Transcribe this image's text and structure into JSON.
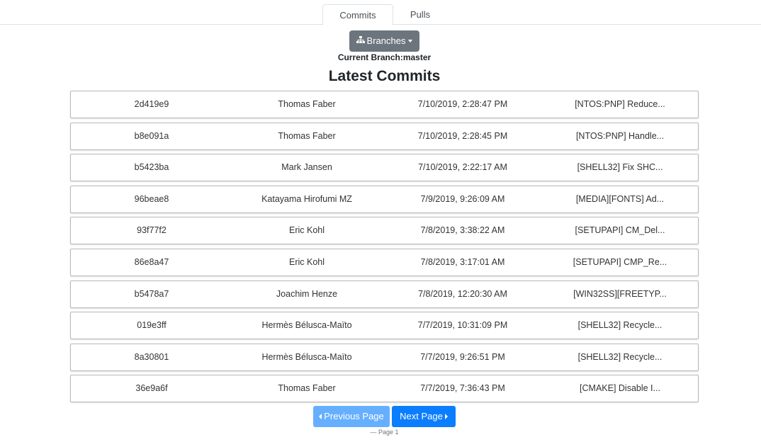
{
  "tabs": [
    {
      "label": "Commits",
      "active": true
    },
    {
      "label": "Pulls",
      "active": false
    }
  ],
  "branch_button": {
    "label": "Branches",
    "icon": "sitemap-icon"
  },
  "current_branch": "Current Branch:master",
  "title": "Latest Commits",
  "commits": [
    {
      "hash": "2d419e9",
      "author": "Thomas Faber",
      "date": "7/10/2019, 2:28:47 PM",
      "message": "[NTOS:PNP] Reduce..."
    },
    {
      "hash": "b8e091a",
      "author": "Thomas Faber",
      "date": "7/10/2019, 2:28:45 PM",
      "message": "[NTOS:PNP] Handle..."
    },
    {
      "hash": "b5423ba",
      "author": "Mark Jansen",
      "date": "7/10/2019, 2:22:17 AM",
      "message": "[SHELL32] Fix SHC..."
    },
    {
      "hash": "96beae8",
      "author": "Katayama Hirofumi MZ",
      "date": "7/9/2019, 9:26:09 AM",
      "message": "[MEDIA][FONTS] Ad..."
    },
    {
      "hash": "93f77f2",
      "author": "Eric Kohl",
      "date": "7/8/2019, 3:38:22 AM",
      "message": "[SETUPAPI] CM_Del..."
    },
    {
      "hash": "86e8a47",
      "author": "Eric Kohl",
      "date": "7/8/2019, 3:17:01 AM",
      "message": "[SETUPAPI] CMP_Re..."
    },
    {
      "hash": "b5478a7",
      "author": "Joachim Henze",
      "date": "7/8/2019, 12:20:30 AM",
      "message": "[WIN32SS][FREETYP..."
    },
    {
      "hash": "019e3ff",
      "author": "Hermès Bélusca-Maïto",
      "date": "7/7/2019, 10:31:09 PM",
      "message": "[SHELL32] Recycle..."
    },
    {
      "hash": "8a30801",
      "author": "Hermès Bélusca-Maïto",
      "date": "7/7/2019, 9:26:51 PM",
      "message": "[SHELL32] Recycle..."
    },
    {
      "hash": "36e9a6f",
      "author": "Thomas Faber",
      "date": "7/7/2019, 7:36:43 PM",
      "message": "[CMAKE] Disable I..."
    }
  ],
  "pagination": {
    "prev_label": "Previous Page",
    "next_label": "Next Page",
    "page_text": "— Page 1"
  },
  "colors": {
    "branch_button": "#6c757d",
    "prev_button": "#66afff",
    "next_button": "#0b7dff"
  }
}
